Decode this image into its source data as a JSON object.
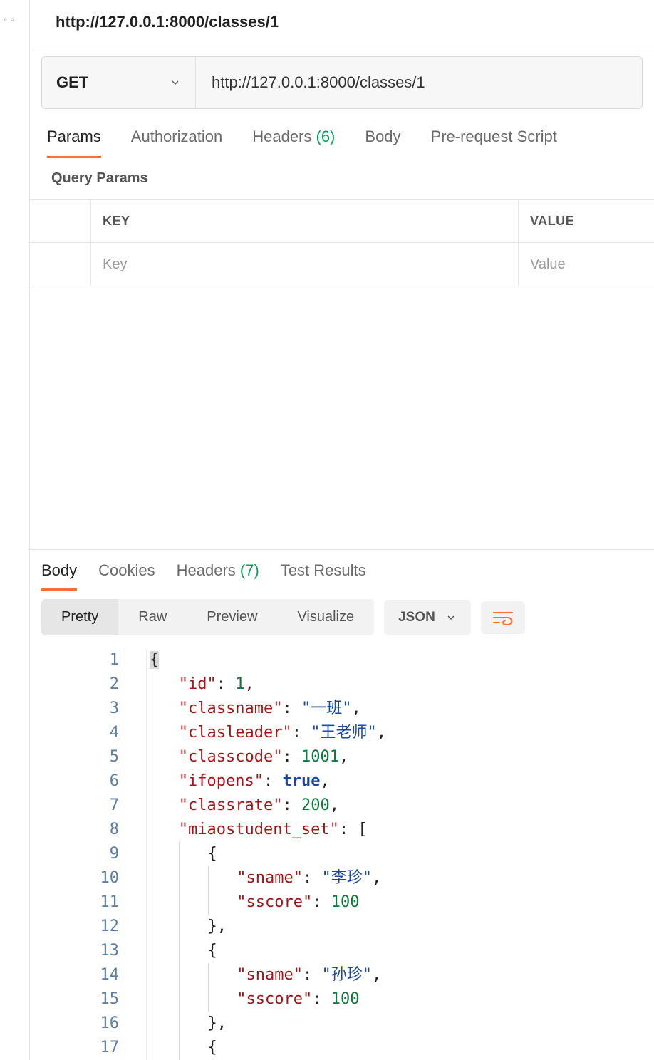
{
  "title": "http://127.0.0.1:8000/classes/1",
  "request": {
    "method": "GET",
    "url": "http://127.0.0.1:8000/classes/1"
  },
  "req_tabs": {
    "params": "Params",
    "authorization": "Authorization",
    "headers": "Headers",
    "headers_count": "(6)",
    "body": "Body",
    "pre_request": "Pre-request Script"
  },
  "query_params": {
    "section_label": "Query Params",
    "key_header": "KEY",
    "value_header": "VALUE",
    "key_placeholder": "Key",
    "value_placeholder": "Value"
  },
  "resp_tabs": {
    "body": "Body",
    "cookies": "Cookies",
    "headers": "Headers",
    "headers_count": "(7)",
    "test_results": "Test Results"
  },
  "view_modes": {
    "pretty": "Pretty",
    "raw": "Raw",
    "preview": "Preview",
    "visualize": "Visualize"
  },
  "format_label": "JSON",
  "code_lines": [
    [
      {
        "t": "punc",
        "v": "{",
        "bg": true
      }
    ],
    [
      {
        "t": "indent",
        "v": 1
      },
      {
        "t": "key",
        "v": "\"id\""
      },
      {
        "t": "punc",
        "v": ": "
      },
      {
        "t": "num",
        "v": "1"
      },
      {
        "t": "punc",
        "v": ","
      }
    ],
    [
      {
        "t": "indent",
        "v": 1
      },
      {
        "t": "key",
        "v": "\"classname\""
      },
      {
        "t": "punc",
        "v": ": "
      },
      {
        "t": "str",
        "v": "\"一班\""
      },
      {
        "t": "punc",
        "v": ","
      }
    ],
    [
      {
        "t": "indent",
        "v": 1
      },
      {
        "t": "key",
        "v": "\"clasleader\""
      },
      {
        "t": "punc",
        "v": ": "
      },
      {
        "t": "str",
        "v": "\"王老师\""
      },
      {
        "t": "punc",
        "v": ","
      }
    ],
    [
      {
        "t": "indent",
        "v": 1
      },
      {
        "t": "key",
        "v": "\"classcode\""
      },
      {
        "t": "punc",
        "v": ": "
      },
      {
        "t": "num",
        "v": "1001"
      },
      {
        "t": "punc",
        "v": ","
      }
    ],
    [
      {
        "t": "indent",
        "v": 1
      },
      {
        "t": "key",
        "v": "\"ifopens\""
      },
      {
        "t": "punc",
        "v": ": "
      },
      {
        "t": "bool",
        "v": "true"
      },
      {
        "t": "punc",
        "v": ","
      }
    ],
    [
      {
        "t": "indent",
        "v": 1
      },
      {
        "t": "key",
        "v": "\"classrate\""
      },
      {
        "t": "punc",
        "v": ": "
      },
      {
        "t": "num",
        "v": "200"
      },
      {
        "t": "punc",
        "v": ","
      }
    ],
    [
      {
        "t": "indent",
        "v": 1
      },
      {
        "t": "key",
        "v": "\"miaostudent_set\""
      },
      {
        "t": "punc",
        "v": ": ["
      }
    ],
    [
      {
        "t": "indent",
        "v": 2
      },
      {
        "t": "punc",
        "v": "{"
      }
    ],
    [
      {
        "t": "indent",
        "v": 3
      },
      {
        "t": "key",
        "v": "\"sname\""
      },
      {
        "t": "punc",
        "v": ": "
      },
      {
        "t": "str",
        "v": "\"李珍\""
      },
      {
        "t": "punc",
        "v": ","
      }
    ],
    [
      {
        "t": "indent",
        "v": 3
      },
      {
        "t": "key",
        "v": "\"sscore\""
      },
      {
        "t": "punc",
        "v": ": "
      },
      {
        "t": "num",
        "v": "100"
      }
    ],
    [
      {
        "t": "indent",
        "v": 2
      },
      {
        "t": "punc",
        "v": "},"
      }
    ],
    [
      {
        "t": "indent",
        "v": 2
      },
      {
        "t": "punc",
        "v": "{"
      }
    ],
    [
      {
        "t": "indent",
        "v": 3
      },
      {
        "t": "key",
        "v": "\"sname\""
      },
      {
        "t": "punc",
        "v": ": "
      },
      {
        "t": "str",
        "v": "\"孙珍\""
      },
      {
        "t": "punc",
        "v": ","
      }
    ],
    [
      {
        "t": "indent",
        "v": 3
      },
      {
        "t": "key",
        "v": "\"sscore\""
      },
      {
        "t": "punc",
        "v": ": "
      },
      {
        "t": "num",
        "v": "100"
      }
    ],
    [
      {
        "t": "indent",
        "v": 2
      },
      {
        "t": "punc",
        "v": "},"
      }
    ],
    [
      {
        "t": "indent",
        "v": 2
      },
      {
        "t": "punc",
        "v": "{"
      }
    ]
  ]
}
